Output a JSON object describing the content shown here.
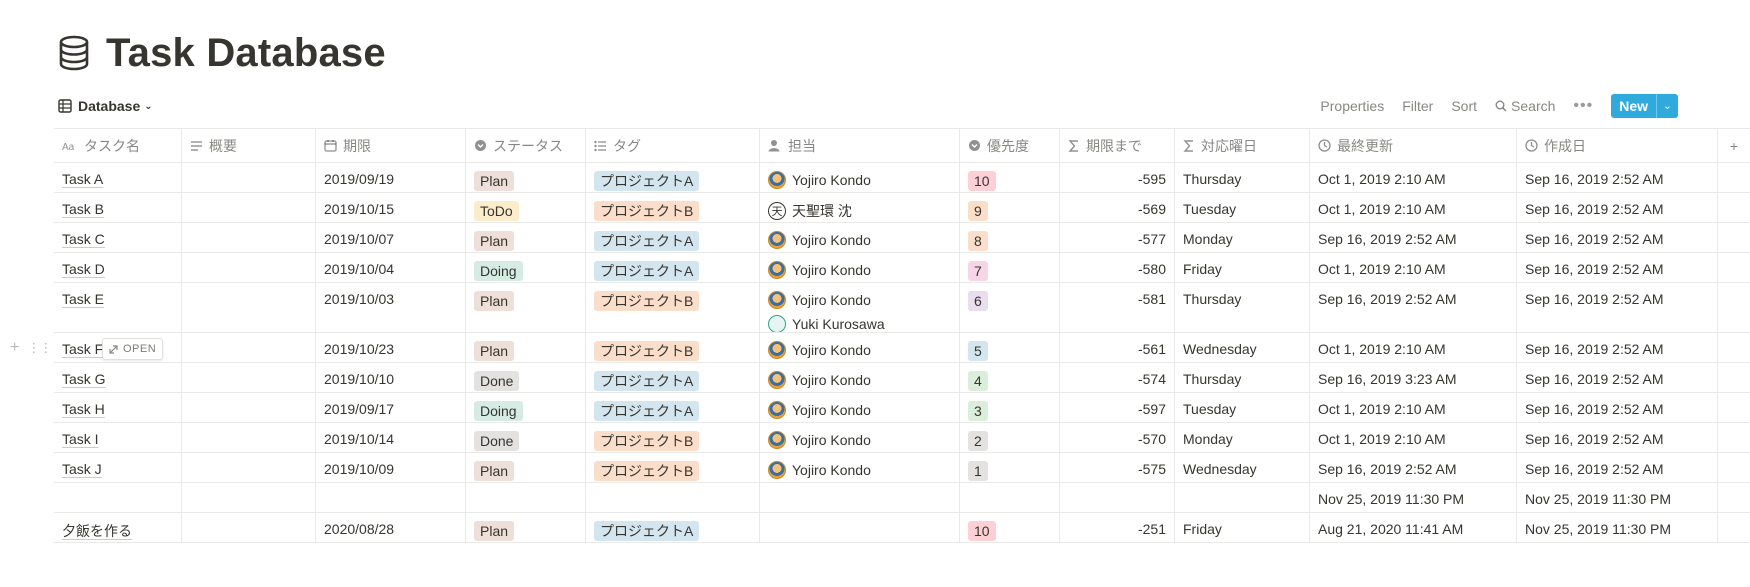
{
  "page": {
    "title": "Task Database",
    "icon": "database-icon"
  },
  "toolbar": {
    "view_label": "Database",
    "properties_label": "Properties",
    "filter_label": "Filter",
    "sort_label": "Sort",
    "search_label": "Search",
    "more_label": "•••",
    "new_label": "New"
  },
  "columns": [
    {
      "label": "タスク名",
      "icon": "title-aa-icon"
    },
    {
      "label": "概要",
      "icon": "text-lines-icon"
    },
    {
      "label": "期限",
      "icon": "calendar-icon"
    },
    {
      "label": "ステータス",
      "icon": "select-circle-icon"
    },
    {
      "label": "タグ",
      "icon": "list-icon"
    },
    {
      "label": "担当",
      "icon": "person-icon"
    },
    {
      "label": "優先度",
      "icon": "select-circle-icon"
    },
    {
      "label": "期限まで",
      "icon": "sigma-icon"
    },
    {
      "label": "対応曜日",
      "icon": "sigma-icon"
    },
    {
      "label": "最終更新",
      "icon": "clock-icon"
    },
    {
      "label": "作成日",
      "icon": "clock-icon"
    }
  ],
  "add_column_label": "+",
  "open_label": "OPEN",
  "colors": {
    "status": {
      "Plan": "#eedfd9",
      "ToDo": "#fbeccb",
      "Doing": "#d6ebe4",
      "Done": "#e3e2e0"
    },
    "tag": {
      "プロジェクトA": "#d3e5ef",
      "プロジェクトB": "#fadec9"
    },
    "priority": {
      "10": "#ffcfd6",
      "9": "#fadec9",
      "8": "#fadec9",
      "7": "#f5d5e6",
      "6": "#e8deee",
      "5": "#d3e5ef",
      "4": "#dbeddb",
      "3": "#dbeddb",
      "2": "#e3e2e0",
      "1": "#e3e2e0"
    },
    "accent": "#2eaadc"
  },
  "rows": [
    {
      "name": "Task A",
      "summary": "",
      "due": "2019/09/19",
      "status": "Plan",
      "tag": "プロジェクトA",
      "owners": [
        {
          "name": "Yojiro Kondo",
          "avatar": "yojiro"
        }
      ],
      "priority": "10",
      "until": "-595",
      "weekday": "Thursday",
      "updated": "Oct 1, 2019 2:10 AM",
      "created": "Sep 16, 2019 2:52 AM"
    },
    {
      "name": "Task B",
      "summary": "",
      "due": "2019/10/15",
      "status": "ToDo",
      "tag": "プロジェクトB",
      "owners": [
        {
          "name": "天聖環 沈",
          "avatar": "kanji",
          "initial": "天"
        }
      ],
      "priority": "9",
      "until": "-569",
      "weekday": "Tuesday",
      "updated": "Oct 1, 2019 2:10 AM",
      "created": "Sep 16, 2019 2:52 AM"
    },
    {
      "name": "Task C",
      "summary": "",
      "due": "2019/10/07",
      "status": "Plan",
      "tag": "プロジェクトA",
      "owners": [
        {
          "name": "Yojiro Kondo",
          "avatar": "yojiro"
        }
      ],
      "priority": "8",
      "until": "-577",
      "weekday": "Monday",
      "updated": "Sep 16, 2019 2:52 AM",
      "created": "Sep 16, 2019 2:52 AM"
    },
    {
      "name": "Task D",
      "summary": "",
      "due": "2019/10/04",
      "status": "Doing",
      "tag": "プロジェクトA",
      "owners": [
        {
          "name": "Yojiro Kondo",
          "avatar": "yojiro"
        }
      ],
      "priority": "7",
      "until": "-580",
      "weekday": "Friday",
      "updated": "Oct 1, 2019 2:10 AM",
      "created": "Sep 16, 2019 2:52 AM"
    },
    {
      "name": "Task E",
      "summary": "",
      "due": "2019/10/03",
      "status": "Plan",
      "tag": "プロジェクトB",
      "owners": [
        {
          "name": "Yojiro Kondo",
          "avatar": "yojiro"
        },
        {
          "name": "Yuki Kurosawa",
          "avatar": "yuki"
        }
      ],
      "priority": "6",
      "until": "-581",
      "weekday": "Thursday",
      "updated": "Sep 16, 2019 2:52 AM",
      "created": "Sep 16, 2019 2:52 AM"
    },
    {
      "name": "Task F",
      "summary": "",
      "due": "2019/10/23",
      "status": "Plan",
      "tag": "プロジェクトB",
      "owners": [
        {
          "name": "Yojiro Kondo",
          "avatar": "yojiro"
        }
      ],
      "priority": "5",
      "until": "-561",
      "weekday": "Wednesday",
      "updated": "Oct 1, 2019 2:10 AM",
      "created": "Sep 16, 2019 2:52 AM",
      "hovered": true
    },
    {
      "name": "Task G",
      "summary": "",
      "due": "2019/10/10",
      "status": "Done",
      "tag": "プロジェクトA",
      "owners": [
        {
          "name": "Yojiro Kondo",
          "avatar": "yojiro"
        }
      ],
      "priority": "4",
      "until": "-574",
      "weekday": "Thursday",
      "updated": "Sep 16, 2019 3:23 AM",
      "created": "Sep 16, 2019 2:52 AM"
    },
    {
      "name": "Task H",
      "summary": "",
      "due": "2019/09/17",
      "status": "Doing",
      "tag": "プロジェクトA",
      "owners": [
        {
          "name": "Yojiro Kondo",
          "avatar": "yojiro"
        }
      ],
      "priority": "3",
      "until": "-597",
      "weekday": "Tuesday",
      "updated": "Oct 1, 2019 2:10 AM",
      "created": "Sep 16, 2019 2:52 AM"
    },
    {
      "name": "Task I",
      "summary": "",
      "due": "2019/10/14",
      "status": "Done",
      "tag": "プロジェクトB",
      "owners": [
        {
          "name": "Yojiro Kondo",
          "avatar": "yojiro"
        }
      ],
      "priority": "2",
      "until": "-570",
      "weekday": "Monday",
      "updated": "Oct 1, 2019 2:10 AM",
      "created": "Sep 16, 2019 2:52 AM"
    },
    {
      "name": "Task J",
      "summary": "",
      "due": "2019/10/09",
      "status": "Plan",
      "tag": "プロジェクトB",
      "owners": [
        {
          "name": "Yojiro Kondo",
          "avatar": "yojiro"
        }
      ],
      "priority": "1",
      "until": "-575",
      "weekday": "Wednesday",
      "updated": "Sep 16, 2019 2:52 AM",
      "created": "Sep 16, 2019 2:52 AM"
    },
    {
      "name": "",
      "summary": "",
      "due": "",
      "status": "",
      "tag": "",
      "owners": [],
      "priority": "",
      "until": "",
      "weekday": "",
      "updated": "Nov 25, 2019 11:30 PM",
      "created": "Nov 25, 2019 11:30 PM"
    },
    {
      "name": "夕飯を作る",
      "summary": "",
      "due": "2020/08/28",
      "status": "Plan",
      "tag": "プロジェクトA",
      "owners": [],
      "priority": "10",
      "until": "-251",
      "weekday": "Friday",
      "updated": "Aug 21, 2020 11:41 AM",
      "created": "Nov 25, 2019 11:30 PM"
    }
  ]
}
